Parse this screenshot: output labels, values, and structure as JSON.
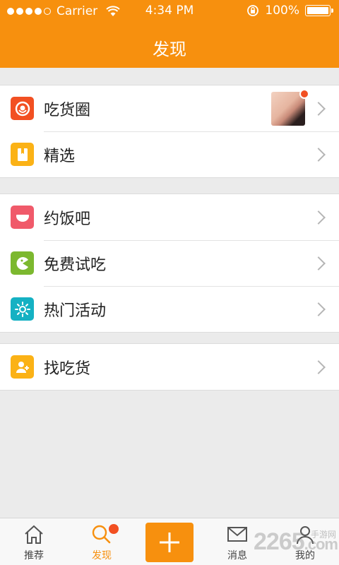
{
  "status_bar": {
    "carrier": "Carrier",
    "time": "4:34 PM",
    "battery": "100%",
    "signal_icon": "signal-dots-icon",
    "wifi_icon": "wifi-icon",
    "lock_icon": "rotation-lock-icon",
    "battery_icon": "battery-icon"
  },
  "header": {
    "title": "发现"
  },
  "groups": [
    {
      "items": [
        {
          "label": "吃货圈",
          "icon": "foodie-circle-icon",
          "color": "#f25022",
          "has_thumbnail": true,
          "has_badge": true
        },
        {
          "label": "精选",
          "icon": "bookmark-icon",
          "color": "#fbb216"
        }
      ]
    },
    {
      "items": [
        {
          "label": "约饭吧",
          "icon": "bowl-icon",
          "color": "#f05a6a"
        },
        {
          "label": "免费试吃",
          "icon": "pacman-icon",
          "color": "#7cb82f"
        },
        {
          "label": "热门活动",
          "icon": "sun-icon",
          "color": "#15b1c3"
        }
      ]
    },
    {
      "items": [
        {
          "label": "找吃货",
          "icon": "add-user-icon",
          "color": "#fbb216"
        }
      ]
    }
  ],
  "tabbar": {
    "tabs": [
      {
        "label": "推荐",
        "icon": "home-icon"
      },
      {
        "label": "发现",
        "icon": "search-icon",
        "active": true,
        "badge": true
      },
      {
        "label": "",
        "icon": "plus-icon"
      },
      {
        "label": "消息",
        "icon": "mail-icon"
      },
      {
        "label": "我的",
        "icon": "person-icon"
      }
    ]
  },
  "watermark": {
    "text": "2265",
    "suffix": ".com",
    "sub": "手游网"
  },
  "colors": {
    "accent": "#f7900e",
    "background": "#ebebeb",
    "badge": "#f25022"
  }
}
